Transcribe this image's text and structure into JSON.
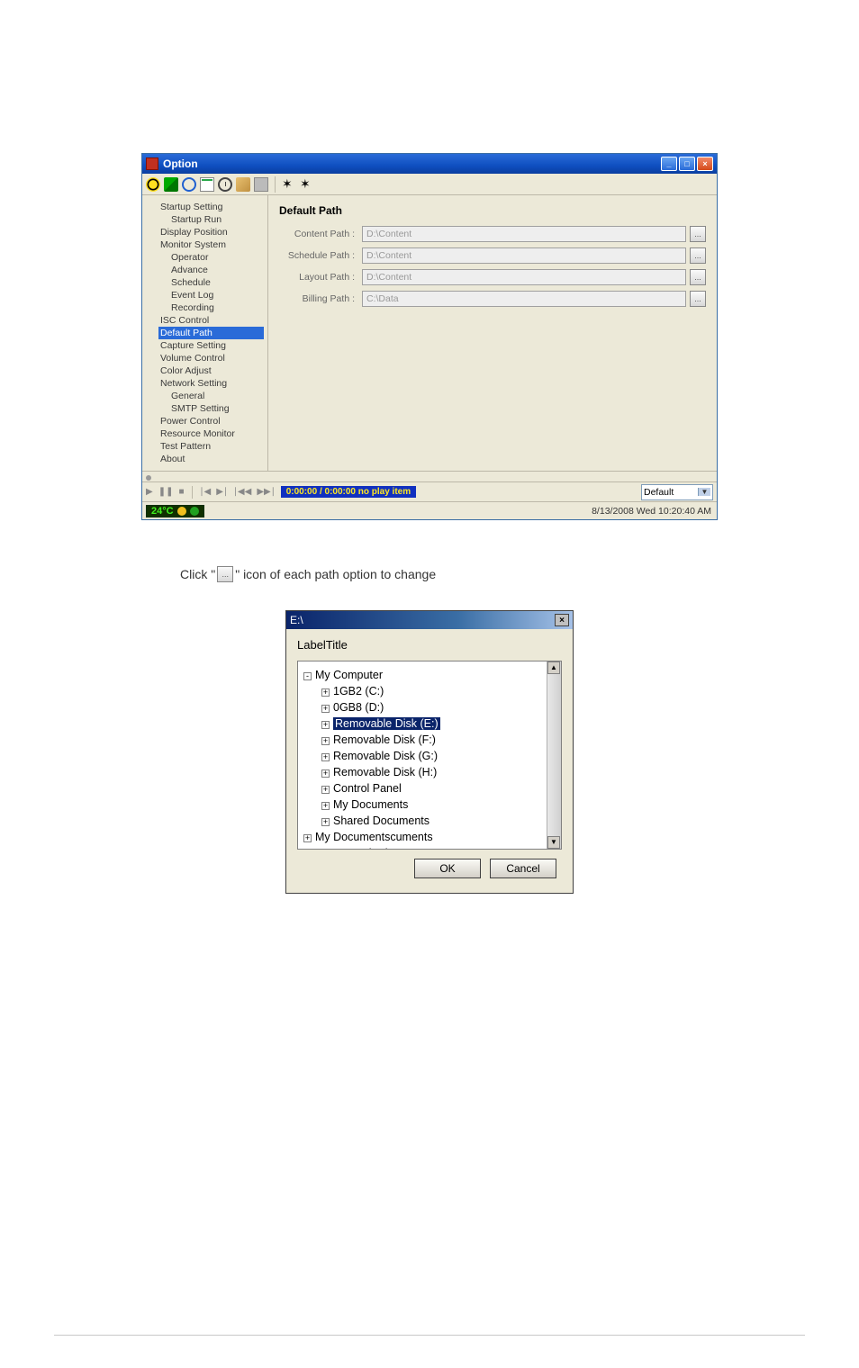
{
  "option_window": {
    "title": "Option",
    "sysbtns": {
      "min": "_",
      "max": "□",
      "close": "×"
    },
    "tree": [
      {
        "lvl": 1,
        "label": "Startup Setting"
      },
      {
        "lvl": 2,
        "label": "Startup Run"
      },
      {
        "lvl": 1,
        "label": "Display Position"
      },
      {
        "lvl": 1,
        "label": "Monitor System"
      },
      {
        "lvl": 2,
        "label": "Operator"
      },
      {
        "lvl": 2,
        "label": "Advance"
      },
      {
        "lvl": 2,
        "label": "Schedule"
      },
      {
        "lvl": 2,
        "label": "Event Log"
      },
      {
        "lvl": 2,
        "label": "Recording"
      },
      {
        "lvl": 1,
        "label": "ISC Control"
      },
      {
        "lvl": 1,
        "label": "Default Path",
        "sel": true
      },
      {
        "lvl": 1,
        "label": "Capture Setting"
      },
      {
        "lvl": 1,
        "label": "Volume Control"
      },
      {
        "lvl": 1,
        "label": "Color Adjust"
      },
      {
        "lvl": 1,
        "label": "Network Setting"
      },
      {
        "lvl": 2,
        "label": "General"
      },
      {
        "lvl": 2,
        "label": "SMTP Setting"
      },
      {
        "lvl": 1,
        "label": "Power Control"
      },
      {
        "lvl": 1,
        "label": "Resource Monitor"
      },
      {
        "lvl": 1,
        "label": "Test Pattern"
      },
      {
        "lvl": 1,
        "label": "About"
      }
    ],
    "pane_title": "Default Path",
    "rows": {
      "content": {
        "label": "Content Path :",
        "value": "D:\\Content"
      },
      "schedule": {
        "label": "Schedule Path :",
        "value": "D:\\Content"
      },
      "layout": {
        "label": "Layout Path :",
        "value": "D:\\Content"
      },
      "billing": {
        "label": "Billing Path :",
        "value": "C:\\Data"
      }
    },
    "browse_glyph": "...",
    "playback": {
      "time_text": "0:00:00 / 0:00:00  no play item",
      "select_value": "Default"
    },
    "status": {
      "left_text": "24°C",
      "datetime": "8/13/2008 Wed 10:20:40 AM"
    }
  },
  "paragraph": {
    "before": "Click \"",
    "after": "\" icon of each path option to change"
  },
  "browse_dialog": {
    "title": "E:\\",
    "close": "×",
    "label": "LabelTitle",
    "nodes": [
      {
        "lvl": 0,
        "exp": "-",
        "label": "My Computer"
      },
      {
        "lvl": 1,
        "exp": "+",
        "label": "1GB2 (C:)"
      },
      {
        "lvl": 1,
        "exp": "+",
        "label": "0GB8 (D:)"
      },
      {
        "lvl": 1,
        "exp": "+",
        "label": "Removable Disk (E:)",
        "sel": true
      },
      {
        "lvl": 1,
        "exp": "+",
        "label": "Removable Disk (F:)"
      },
      {
        "lvl": 1,
        "exp": "+",
        "label": "Removable Disk (G:)"
      },
      {
        "lvl": 1,
        "exp": "+",
        "label": "Removable Disk (H:)"
      },
      {
        "lvl": 1,
        "exp": "+",
        "label": "Control Panel"
      },
      {
        "lvl": 1,
        "exp": "+",
        "label": "My Documents"
      },
      {
        "lvl": 1,
        "exp": "+",
        "label": "Shared Documents"
      },
      {
        "lvl": 0,
        "exp": "+",
        "label": "My Documentscuments"
      },
      {
        "lvl": 0,
        "exp": "+",
        "label": "My Network Places"
      }
    ],
    "ok": "OK",
    "cancel": "Cancel"
  }
}
